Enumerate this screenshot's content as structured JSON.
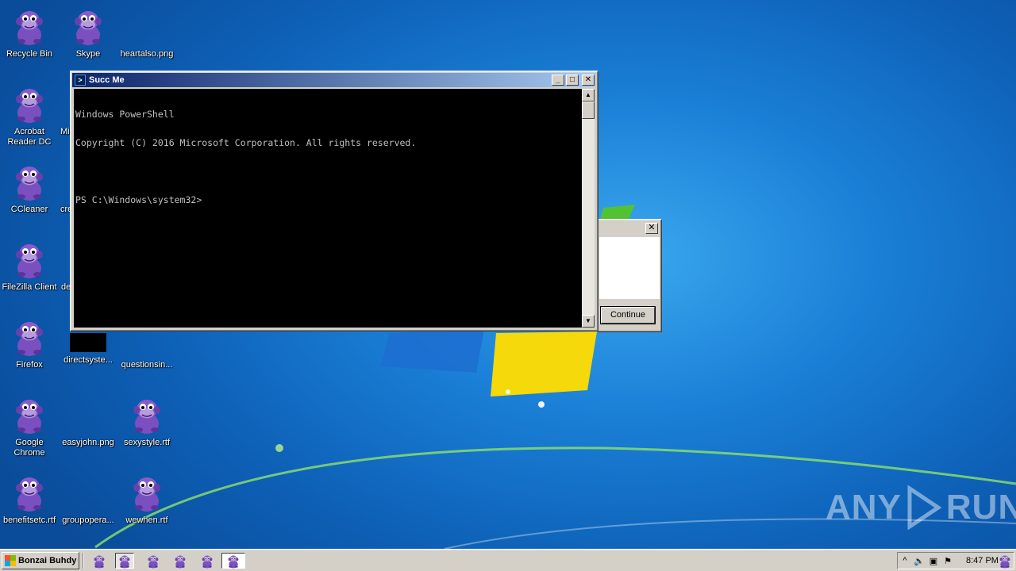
{
  "desktop": {
    "icons": [
      {
        "label": "Recycle Bin"
      },
      {
        "label": "Skype"
      },
      {
        "label": "heartalso.png"
      },
      {
        "label": "Acrobat Reader DC"
      },
      {
        "label": "Mi"
      },
      {
        "label": "CCleaner"
      },
      {
        "label": "cre"
      },
      {
        "label": "FileZilla Client"
      },
      {
        "label": "de"
      },
      {
        "label": "Firefox"
      },
      {
        "label": "directsyste..."
      },
      {
        "label": "questionsin..."
      },
      {
        "label": "Google Chrome"
      },
      {
        "label": "easyjohn.png"
      },
      {
        "label": "sexystyle.rtf"
      },
      {
        "label": "benefitsetc.rtf"
      },
      {
        "label": "groupopera..."
      },
      {
        "label": "wewhen.rtf"
      }
    ]
  },
  "powershell_window": {
    "title": "Succ Me",
    "console_lines": [
      "Windows PowerShell",
      "Copyright (C) 2016 Microsoft Corporation. All rights reserved.",
      "",
      "PS C:\\Windows\\system32>"
    ]
  },
  "dialog": {
    "close_glyph": "✕",
    "button_label": "Continue"
  },
  "watermark": {
    "left": "ANY",
    "right": "RUN"
  },
  "taskbar": {
    "start_label": "Bonzai Buhdy",
    "clock": "8:47 PM"
  },
  "colors": {
    "titlebar_start": "#0a246a",
    "titlebar_end": "#a6caf0",
    "console_bg": "#000000",
    "console_fg": "#c0c0c0",
    "desktop_blue": "#1a7fd6",
    "bonzi_purple": "#8a5cc9"
  }
}
